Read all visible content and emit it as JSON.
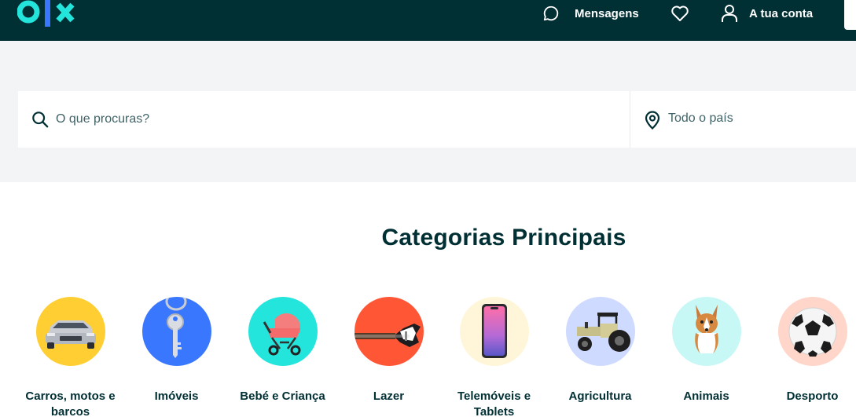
{
  "header": {
    "logo_text": "olx",
    "messages_label": "Mensagens",
    "account_label": "A tua conta"
  },
  "search": {
    "placeholder": "O que procuras?",
    "location": "Todo o país"
  },
  "categories": {
    "title": "Categorias Principais",
    "items": [
      {
        "label": "Carros, motos e barcos",
        "icon": "car-icon",
        "bg": "#ffce32"
      },
      {
        "label": "Imóveis",
        "icon": "key-icon",
        "bg": "#3a77ff"
      },
      {
        "label": "Bebé e Criança",
        "icon": "stroller-icon",
        "bg": "#23e5db"
      },
      {
        "label": "Lazer",
        "icon": "guitar-icon",
        "bg": "#ff5636"
      },
      {
        "label": "Telemóveis e Tablets",
        "icon": "smartphone-icon",
        "bg": "#fff6d9"
      },
      {
        "label": "Agricultura",
        "icon": "tractor-icon",
        "bg": "#cedaff"
      },
      {
        "label": "Animais",
        "icon": "dog-icon",
        "bg": "#c8f8f6"
      },
      {
        "label": "Desporto",
        "icon": "football-icon",
        "bg": "#ffd6c9"
      }
    ]
  }
}
